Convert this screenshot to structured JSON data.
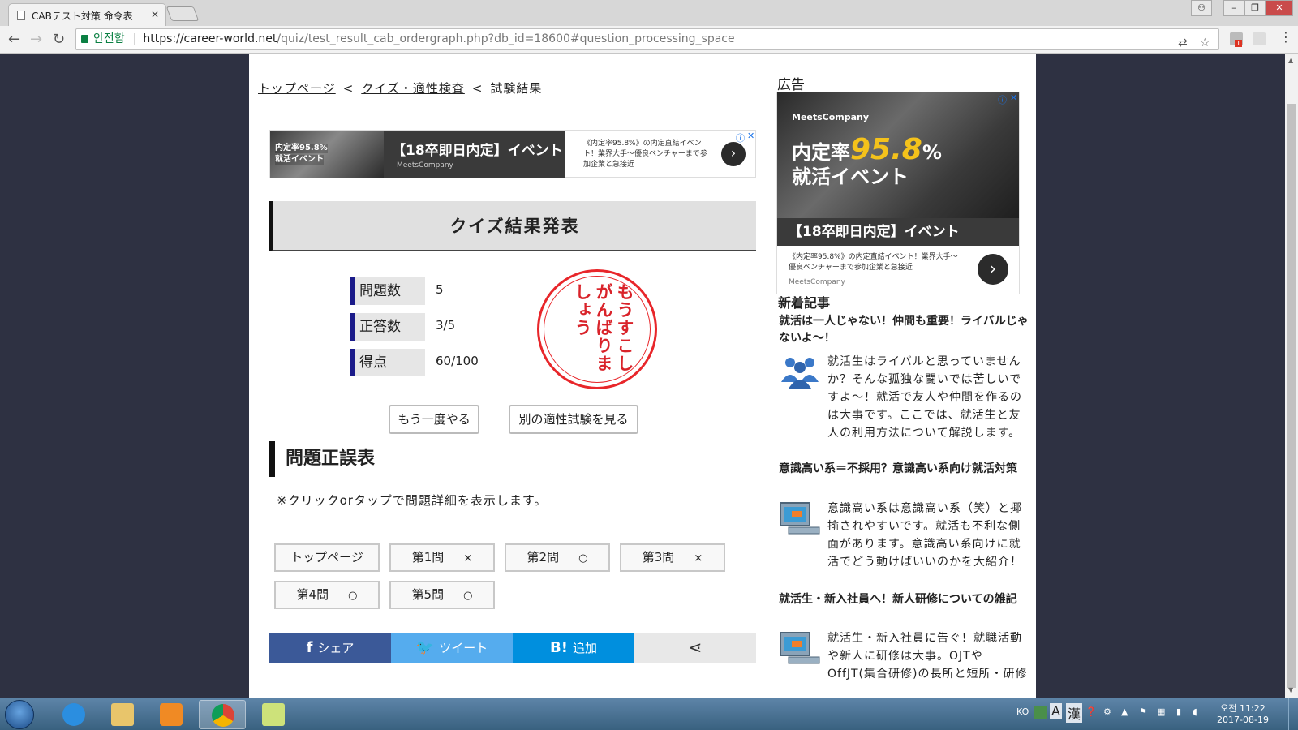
{
  "browser": {
    "tab_title": "CABテスト対策 命令表",
    "secure_label": "안전함",
    "url_host": "https://career-world.net",
    "url_path": "/quiz/test_result_cab_ordergraph.php?db_id=18600#question_processing_space",
    "ext_badge": "1"
  },
  "breadcrumb": {
    "home": "トップページ",
    "quiz": "クイズ・適性検査",
    "current": "試験結果",
    "sep": "<"
  },
  "top_ad": {
    "photo_text_1": "内定率95.8%",
    "photo_text_2": "就活イベント",
    "headline": "【18卒即日内定】イベント",
    "advertiser": "MeetsCompany",
    "description": "《内定率95.8%》の内定直結イベント！業界大手～優良ベンチャーまで参加企業と急接近"
  },
  "result": {
    "title": "クイズ結果発表",
    "stats": [
      {
        "label": "問題数",
        "value": "5"
      },
      {
        "label": "正答数",
        "value": "3/5"
      },
      {
        "label": "得点",
        "value": "60/100"
      }
    ],
    "stamp": "もうすこしがんばりましょう",
    "retry_button": "もう一度やる",
    "other_test_button": "別の適性試験を見る"
  },
  "answer_table": {
    "title": "問題正誤表",
    "note": "※クリックorタップで問題詳細を表示します。",
    "buttons": [
      {
        "label": "トップページ",
        "mark": ""
      },
      {
        "label": "第1問",
        "mark": "×"
      },
      {
        "label": "第2問",
        "mark": "○"
      },
      {
        "label": "第3問",
        "mark": "×"
      },
      {
        "label": "第4問",
        "mark": "○"
      },
      {
        "label": "第5問",
        "mark": "○"
      }
    ]
  },
  "share": {
    "facebook": "シェア",
    "twitter": "ツイート",
    "hatena_icon": "B!",
    "hatena": "追加",
    "colors": {
      "facebook": "#3b5998",
      "twitter": "#55acee",
      "hatena": "#008fde",
      "other": "#e8e8e8"
    }
  },
  "sidebar": {
    "ad_label": "広告",
    "ad": {
      "brand": "MeetsCompany",
      "line1_prefix": "内定率",
      "line1_pct": "95.8",
      "line1_suffix": "%",
      "line2": "就活イベント",
      "headline": "【18卒即日内定】イベント",
      "description": "《内定率95.8%》の内定直結イベント！業界大手～優良ベンチャーまで参加企業と急接近",
      "source": "MeetsCompany"
    },
    "news_heading": "新着記事",
    "articles": [
      {
        "title": "就活は一人じゃない！仲間も重要！ライバルじゃないよ～！",
        "body": "就活生はライバルと思っていませんか？そんな孤独な闘いでは苦しいですよ～！就活で友人や仲間を作るのは大事です。ここでは、就活生と友人の利用方法について解説します。",
        "icon": "people-icon"
      },
      {
        "title": "意識高い系＝不採用？意識高い系向け就活対策",
        "body": "意識高い系は意識高い系（笑）と揶揄されやすいです。就活も不利な側面があります。意識高い系向けに就活でどう動けばいいのかを大紹介！",
        "icon": "computer-icon"
      },
      {
        "title": "就活生・新入社員へ！新人研修についての雑記",
        "body": "就活生・新入社員に告ぐ！就職活動や新人に研修は大事。OJTやOffJT(集合研修)の長所と短所・研修",
        "icon": "computer-icon"
      }
    ]
  },
  "taskbar": {
    "lang": "KO",
    "ime_a": "A",
    "ime_kanji": "漢",
    "time": "오전 11:22",
    "date": "2017-08-19"
  }
}
